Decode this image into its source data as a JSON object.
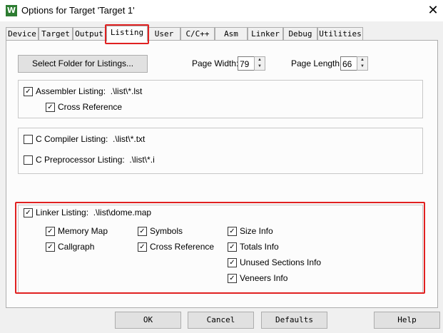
{
  "window": {
    "title": "Options for Target 'Target 1'"
  },
  "tabs": [
    "Device",
    "Target",
    "Output",
    "Listing",
    "User",
    "C/C++",
    "Asm",
    "Linker",
    "Debug",
    "Utilities"
  ],
  "listing": {
    "select_folder": "Select Folder for Listings...",
    "page_width_label": "Page Width:",
    "page_width": "79",
    "page_length_label": "Page Length:",
    "page_length": "66",
    "assembler": {
      "label": "Assembler Listing:",
      "path": ".\\list\\*.lst",
      "checked": true
    },
    "cross_ref": {
      "label": "Cross Reference",
      "checked": true
    },
    "c_compiler": {
      "label": "C Compiler Listing:",
      "path": ".\\list\\*.txt",
      "checked": false
    },
    "c_preproc": {
      "label": "C Preprocessor Listing:",
      "path": ".\\list\\*.i",
      "checked": false
    },
    "linker": {
      "label": "Linker Listing:",
      "path": ".\\list\\dome.map",
      "checked": true
    },
    "linker_options": {
      "memory_map": "Memory Map",
      "symbols": "Symbols",
      "size_info": "Size Info",
      "callgraph": "Callgraph",
      "cross_reference": "Cross Reference",
      "totals_info": "Totals Info",
      "unused_sections": "Unused Sections Info",
      "veneers_info": "Veneers Info"
    }
  },
  "buttons": {
    "ok": "OK",
    "cancel": "Cancel",
    "defaults": "Defaults",
    "help": "Help"
  },
  "colors": {
    "highlight": "#e02020",
    "checkmark": "#000000"
  }
}
